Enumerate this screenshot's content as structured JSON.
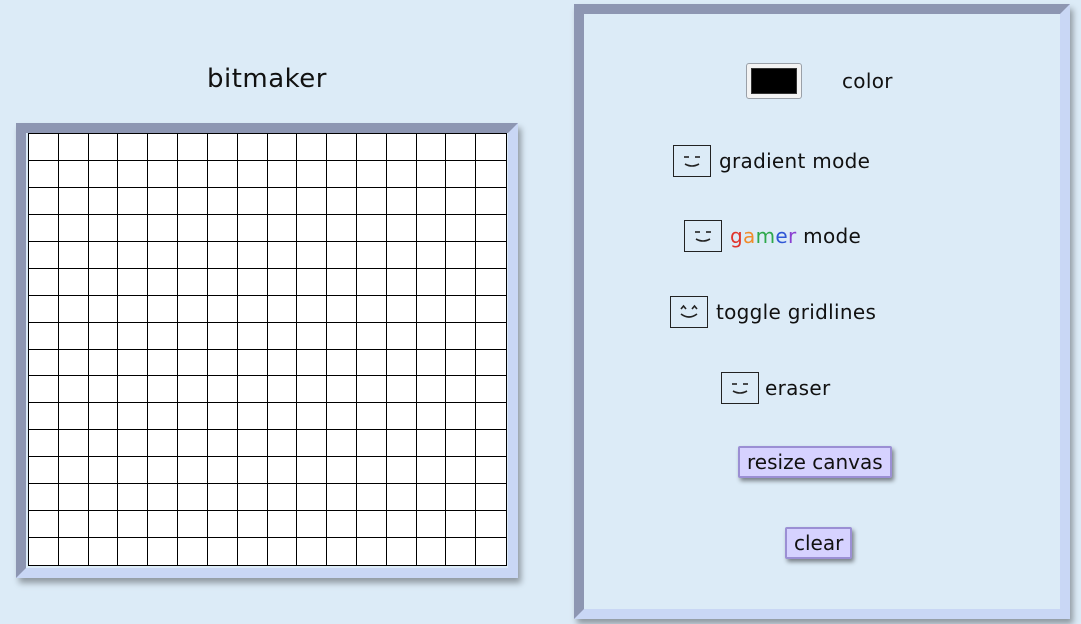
{
  "app": {
    "title": "bitmaker"
  },
  "canvas": {
    "columns": 16,
    "rows": 16,
    "background": "#ffffff",
    "gridline_color": "#000000"
  },
  "controls": {
    "color": {
      "label": "color",
      "value": "#000000"
    },
    "gradient_mode": {
      "label": "gradient mode"
    },
    "gamer_mode": {
      "label_letters": [
        {
          "ch": "g",
          "color": "#e0332b"
        },
        {
          "ch": "a",
          "color": "#f08c2b"
        },
        {
          "ch": "m",
          "color": "#2da84a"
        },
        {
          "ch": "e",
          "color": "#2f57d6"
        },
        {
          "ch": "r",
          "color": "#8a3fd1"
        }
      ],
      "label_rest": " mode"
    },
    "toggle_gridlines": {
      "label": "toggle gridlines"
    },
    "eraser": {
      "label": "eraser"
    },
    "resize_canvas": {
      "label": "resize canvas"
    },
    "clear": {
      "label": "clear"
    }
  }
}
